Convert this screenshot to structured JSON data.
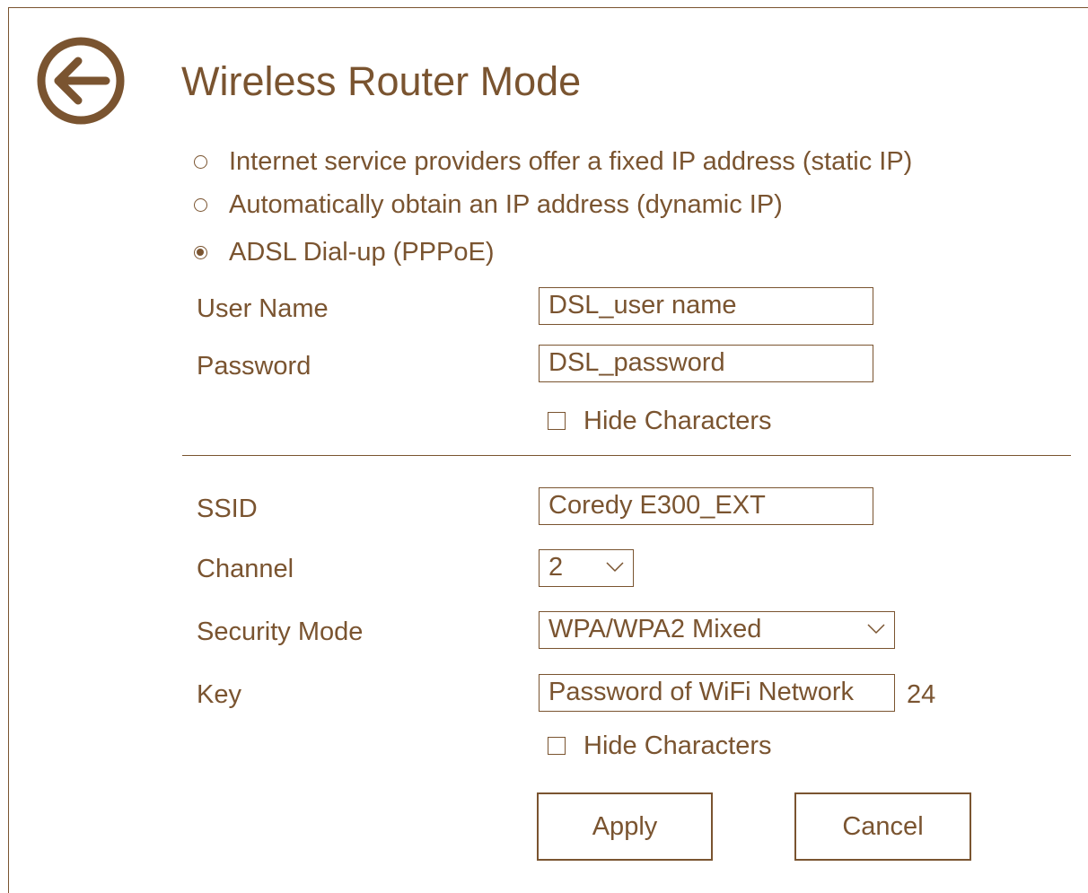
{
  "page": {
    "title": "Wireless Router Mode",
    "accent_color": "#7a5430"
  },
  "back_button": {
    "icon": "arrow-left-circle-icon"
  },
  "wan_options": [
    {
      "label": "Internet service providers offer a fixed IP address (static IP)",
      "selected": false
    },
    {
      "label": "Automatically obtain an IP address (dynamic IP)",
      "selected": false
    },
    {
      "label": "ADSL Dial-up (PPPoE)",
      "selected": true
    }
  ],
  "pppoe": {
    "username_label": "User Name",
    "username_value": "DSL_user name",
    "password_label": "Password",
    "password_value": "DSL_password",
    "hide_chars_label": "Hide Characters",
    "hide_chars_checked": false
  },
  "wireless": {
    "ssid_label": "SSID",
    "ssid_value": "Coredy E300_EXT",
    "channel_label": "Channel",
    "channel_value": "2",
    "security_label": "Security Mode",
    "security_value": "WPA/WPA2 Mixed",
    "key_label": "Key",
    "key_value": "Password of WiFi Network",
    "key_length": "24",
    "hide_chars_label": "Hide Characters",
    "hide_chars_checked": false
  },
  "actions": {
    "apply_label": "Apply",
    "cancel_label": "Cancel"
  }
}
